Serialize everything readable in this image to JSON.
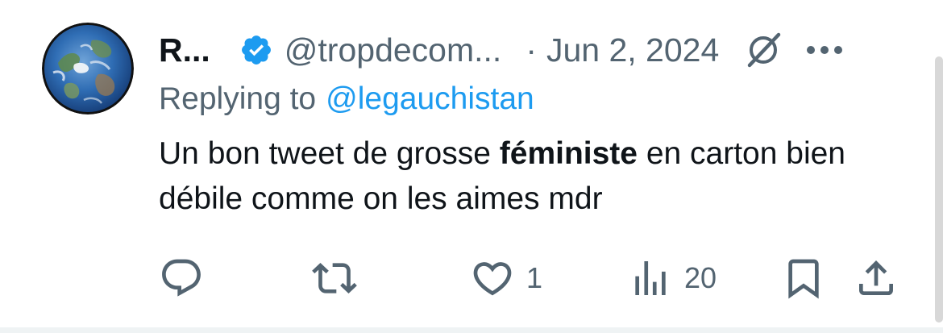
{
  "tweet": {
    "author_name": "R...",
    "author_handle": "@tropdecom...",
    "separator": "·",
    "date": "Jun 2, 2024",
    "reply_prefix": "Replying to",
    "reply_to": "@legauchistan",
    "text_before": "Un bon tweet de grosse ",
    "text_bold": "féministe",
    "text_after": " en carton bien débile comme on les aimes mdr",
    "likes": "1",
    "views": "20"
  },
  "icons": {
    "verified": "verified-badge-icon",
    "grok": "grok-icon",
    "more": "more-icon",
    "reply": "reply-icon",
    "retweet": "retweet-icon",
    "like": "heart-icon",
    "views": "bar-chart-icon",
    "bookmark": "bookmark-icon",
    "share": "share-icon"
  },
  "colors": {
    "text_primary": "#0f1419",
    "text_secondary": "#536471",
    "accent": "#1d9bf0",
    "divider": "#eff3f4"
  }
}
